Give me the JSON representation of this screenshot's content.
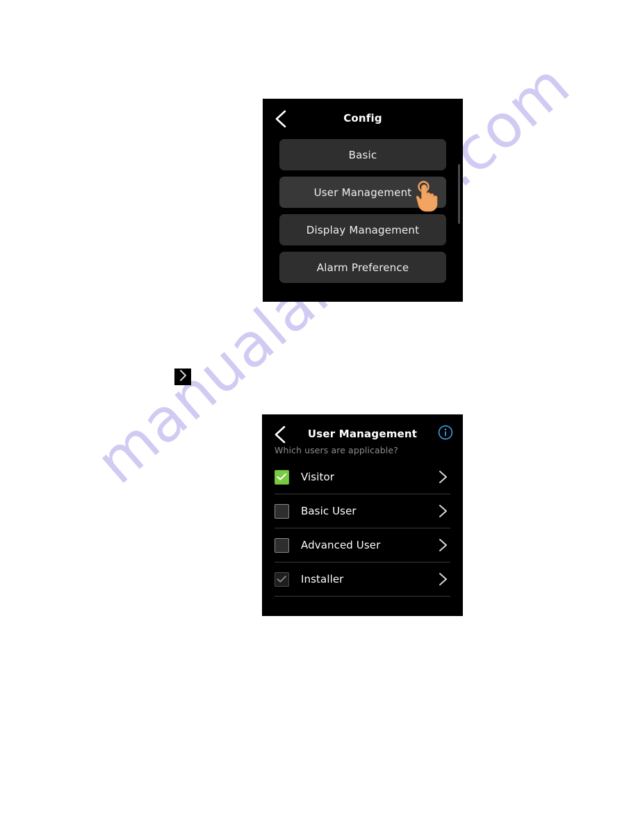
{
  "watermark": {
    "text": "manualarchive.com",
    "color": "#c9c3f2"
  },
  "config_screen": {
    "title": "Config",
    "back_icon": "chevron-left-icon",
    "buttons": [
      {
        "label": "Basic",
        "highlighted": false
      },
      {
        "label": "User Management",
        "highlighted": true
      },
      {
        "label": "Display Management",
        "highlighted": false
      },
      {
        "label": "Alarm Preference",
        "highlighted": false
      }
    ],
    "scrollbar": {
      "visible": true
    },
    "cursor": {
      "icon": "tap-hand-icon",
      "color": "#f2a463",
      "over": "User Management"
    },
    "colors": {
      "background": "#000000",
      "button": "#2f2f2f",
      "text": "#f0f0f0"
    }
  },
  "step_arrow": {
    "icon": "chevron-right-icon",
    "label": ""
  },
  "user_management_screen": {
    "title": "User Management",
    "back_icon": "chevron-left-icon",
    "info_icon": "info-circle-icon",
    "info_icon_color": "#3c9fe0",
    "subtitle": "Which users are applicable?",
    "rows": [
      {
        "label": "Visitor",
        "state": "checked",
        "chevron": "chevron-right-icon"
      },
      {
        "label": "Basic User",
        "state": "unchecked",
        "chevron": "chevron-right-icon"
      },
      {
        "label": "Advanced User",
        "state": "unchecked",
        "chevron": "chevron-right-icon"
      },
      {
        "label": "Installer",
        "state": "disabled",
        "chevron": "chevron-right-icon"
      }
    ],
    "colors": {
      "background": "#000000",
      "checked": "#7ac943",
      "divider": "#3a3a3a",
      "subtitle": "#8d8d8d"
    }
  }
}
